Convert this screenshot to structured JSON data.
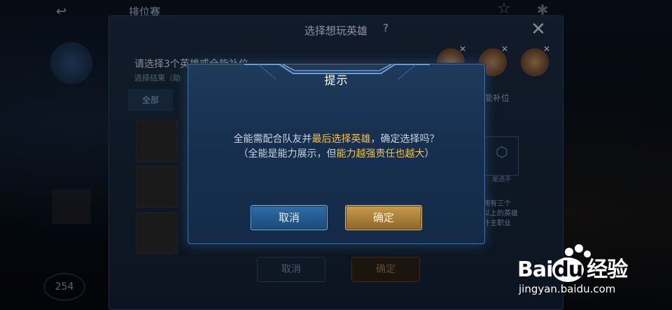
{
  "top_bar": {
    "title": "排位赛"
  },
  "background": {
    "counter": "254"
  },
  "select_panel": {
    "title": "选择想玩英雄",
    "help": "?",
    "close": "✕",
    "instruction": "请选择3个英雄或全能补位",
    "sub_instruction": "选择结果（助",
    "tab_all": "全部",
    "tab_flex": "能补位",
    "role_label": "能选手",
    "note_lines": [
      "拥有三个",
      "以上的英雄",
      "计主职业"
    ],
    "buttons": {
      "cancel": "取消",
      "confirm": "确定"
    }
  },
  "dialog": {
    "title": "提示",
    "line1": {
      "before": "全能需配合队友并",
      "highlight": "最后选择英雄",
      "after": "，确定选择吗？"
    },
    "line2": {
      "before": "（全能是能力展示，但",
      "highlight": "能力越强责任也越大",
      "after": "）"
    },
    "buttons": {
      "cancel": "取消",
      "confirm": "确定"
    }
  },
  "watermark": {
    "brand_a": "Bai",
    "brand_b": "du",
    "brand_c": "经验",
    "url": "jingyan.baidu.com"
  },
  "colors": {
    "highlight": "#f2c24a",
    "dialog_bg": "#173050",
    "confirm_gold": "#c79a4e",
    "cancel_blue": "#2f6ea8"
  }
}
